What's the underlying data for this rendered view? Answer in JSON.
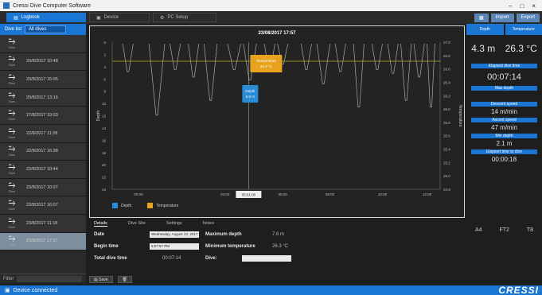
{
  "window": {
    "title": "Cressi Dive Computer Software",
    "controls": [
      "–",
      "□",
      "×"
    ]
  },
  "tabs": [
    {
      "label": "Logbook",
      "icon": "logbook-icon"
    },
    {
      "label": "Device",
      "icon": "device-icon"
    },
    {
      "label": "PC Setup",
      "icon": "settings-icon"
    }
  ],
  "toolbar_buttons": [
    "Import",
    "Export"
  ],
  "sidebar": {
    "header_label": "Dive list",
    "selector_value": "All dives",
    "dives": [
      {
        "date": "",
        "kind": "Dive"
      },
      {
        "date": "20/8/2017 10:48",
        "kind": "Dive"
      },
      {
        "date": "20/8/2017 15:05",
        "kind": "Dive"
      },
      {
        "date": "20/8/2017 13:16",
        "kind": "Dive"
      },
      {
        "date": "27/8/2017 10:03",
        "kind": "Dive"
      },
      {
        "date": "22/8/2017 11:28",
        "kind": "Dive"
      },
      {
        "date": "22/8/2017 16:38",
        "kind": "Dive"
      },
      {
        "date": "22/8/2017 10:44",
        "kind": "Dive"
      },
      {
        "date": "23/8/2017 10:07",
        "kind": "Dive"
      },
      {
        "date": "23/8/2017 16:07",
        "kind": "Dive"
      },
      {
        "date": "23/8/2017 11:18",
        "kind": "Dive"
      },
      {
        "date": "23/8/2017 17:57",
        "kind": "Free"
      }
    ],
    "footer_label": "Filter"
  },
  "chart_data": {
    "type": "line",
    "title": "23/08/2017 17:57",
    "ylabel": "Depth",
    "y2label": "Temperature",
    "ylim": [
      0,
      24
    ],
    "y_ticks": [
      "0",
      "2",
      "4",
      "6",
      "8",
      "10",
      "12",
      "14",
      "16",
      "18",
      "20",
      "22",
      "24"
    ],
    "y2_ticks": [
      "27.0",
      "26.8",
      "26.6",
      "26.4",
      "26.2",
      "26.0",
      "25.8",
      "25.6",
      "25.4",
      "25.2",
      "25.0",
      "24.8"
    ],
    "x_ticks": [
      "00:00",
      "04:00",
      "06:00",
      "08:00",
      "10:00",
      "12:00"
    ],
    "cursor_label": "05:51:00",
    "tooltips": [
      {
        "label": "Temperature",
        "value": "26.3 °C"
      },
      {
        "label": "Depth",
        "value": "0.0 m"
      }
    ],
    "series": [
      {
        "name": "Depth",
        "color": "#9a9a9a",
        "dives": [
          {
            "start": 0.4,
            "end": 0.8,
            "depth": 4.8
          },
          {
            "start": 1.4,
            "end": 2.0,
            "depth": 11.9
          },
          {
            "start": 2.2,
            "end": 2.6,
            "depth": 4.5
          },
          {
            "start": 2.9,
            "end": 3.3,
            "depth": 5.7
          },
          {
            "start": 3.5,
            "end": 4.0,
            "depth": 9.5
          },
          {
            "start": 4.4,
            "end": 4.9,
            "depth": 4.5
          },
          {
            "start": 5.0,
            "end": 5.5,
            "depth": 6.2
          },
          {
            "start": 5.8,
            "end": 6.2,
            "depth": 4.8
          },
          {
            "start": 6.3,
            "end": 6.7,
            "depth": 3.6
          },
          {
            "start": 7.2,
            "end": 7.6,
            "depth": 4.5
          },
          {
            "start": 7.8,
            "end": 8.3,
            "depth": 6.8
          },
          {
            "start": 8.5,
            "end": 8.9,
            "depth": 4.8
          },
          {
            "start": 9.2,
            "end": 9.6,
            "depth": 10.6
          },
          {
            "start": 9.9,
            "end": 10.3,
            "depth": 4.5
          },
          {
            "start": 10.5,
            "end": 10.9,
            "depth": 5.1
          },
          {
            "start": 11.0,
            "end": 11.4,
            "depth": 9.5
          },
          {
            "start": 11.5,
            "end": 11.9,
            "depth": 5.7
          },
          {
            "start": 12.0,
            "end": 12.3,
            "depth": 10.6
          }
        ]
      },
      {
        "name": "Temperature",
        "color": "#e8a21d",
        "value": 26.3
      }
    ],
    "legend": [
      "Depth",
      "Temperature"
    ]
  },
  "stats": {
    "tabs": [
      "Depth",
      "Temperature"
    ],
    "depth_value": "4.3 m",
    "temp_value": "26.3 °C",
    "items": [
      {
        "label": "Elapsed dive time",
        "value": "00:07:14",
        "big": true
      },
      {
        "label": "Max depth",
        "value": ""
      },
      {
        "label": "Descent speed",
        "value": "14 m/min"
      },
      {
        "label": "Ascent speed",
        "value": "47 m/min"
      },
      {
        "label": "Min depth",
        "value": "2.1 m"
      },
      {
        "label": "Elapsed time to dive",
        "value": "00:00:18"
      }
    ],
    "footer": [
      "A4",
      "FT2",
      "T8"
    ]
  },
  "info_tabs": [
    "Details",
    "Dive Site",
    "Settings",
    "Notes"
  ],
  "info": {
    "date_label": "Date",
    "date_value": "Wednesday, August 23, 2017",
    "begin_label": "Begin time",
    "begin_value": "5:57:57 PM",
    "total_label": "Total dive time",
    "total_value": "00:07:14",
    "maxdepth_label": "Maximum depth",
    "maxdepth_value": "7.6 m",
    "mintemp_label": "Minimum temperature",
    "mintemp_value": "26.3 °C",
    "dive_label": "Dive:",
    "dive_value": ""
  },
  "bottom_buttons": [
    "Save",
    "Delete"
  ],
  "statusbar": {
    "left": "Device connected",
    "brand": "CRESSI"
  },
  "colors": {
    "accent": "#1976d2",
    "temp": "#e8a21d",
    "depth_tip": "#2a8bd6"
  }
}
